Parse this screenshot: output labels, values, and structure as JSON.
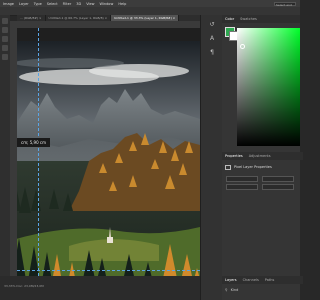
{
  "menubar": {
    "items": [
      "Image",
      "Layer",
      "Type",
      "Select",
      "Filter",
      "3D",
      "View",
      "Window",
      "Help"
    ],
    "search_placeholder": "Select and"
  },
  "tabs": [
    {
      "label": "... (RGB/8#) ×",
      "active": false
    },
    {
      "label": "Untitled-1 @ 66.7% (Layer 1, RGB/8) ×",
      "active": false
    },
    {
      "label": "Untitled-1 @ 33.3% (Layer 1, RGB/8#) ×",
      "active": true
    }
  ],
  "canvas": {
    "measure_label": "cm; 5,90 cm"
  },
  "statusbar": {
    "text": "33,33%   Doc: 23,0M/23,0M"
  },
  "color_panel": {
    "tabs": [
      "Color",
      "Swatches"
    ],
    "foreground": "#2da850",
    "background": "#ffffff"
  },
  "properties_panel": {
    "tabs": [
      "Properties",
      "Adjustments"
    ],
    "section": "Pixel Layer Properties"
  },
  "layers_panel": {
    "tabs": [
      "Layers",
      "Channels",
      "Paths"
    ],
    "filter_label": "Kind"
  }
}
